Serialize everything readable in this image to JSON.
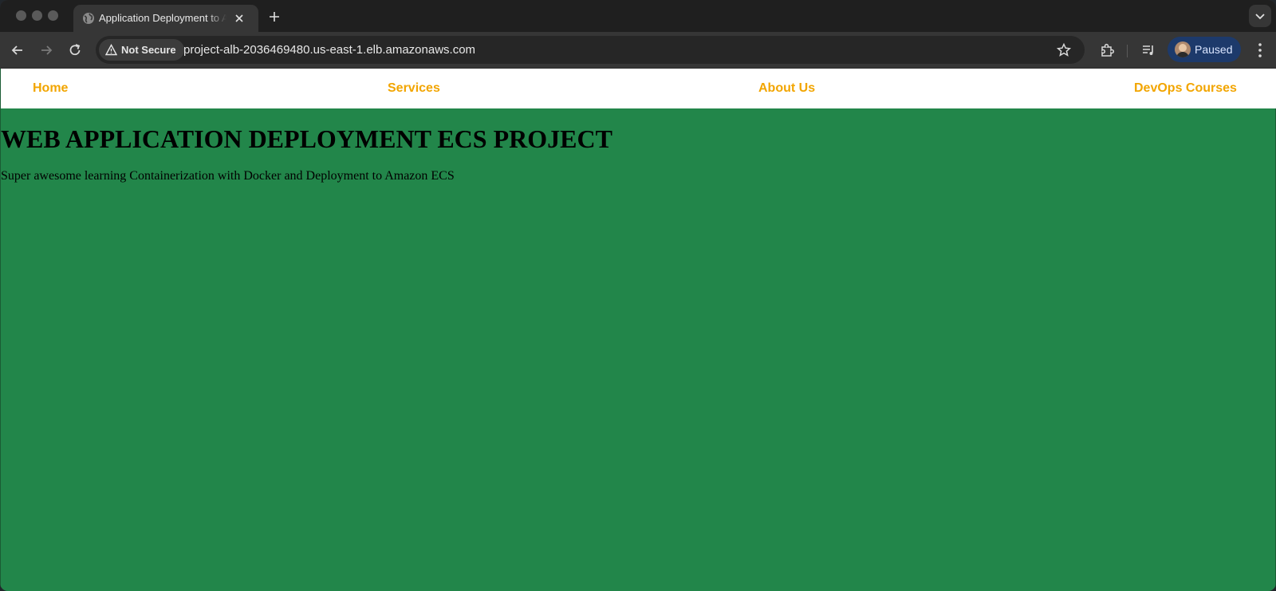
{
  "browser": {
    "tab": {
      "title": "Application Deployment to Amazon ECS",
      "favicon": "globe-icon"
    },
    "omnibox": {
      "security_label": "Not Secure",
      "url": "project-alb-2036469480.us-east-1.elb.amazonaws.com"
    },
    "profile": {
      "label": "Paused"
    },
    "icons": {
      "back": "back-arrow-icon",
      "forward": "forward-arrow-icon",
      "reload": "reload-icon",
      "bookmark": "star-icon",
      "extensions": "puzzle-icon",
      "media": "media-controls-icon",
      "menu": "kebab-menu-icon"
    }
  },
  "site": {
    "nav": [
      {
        "label": "Home"
      },
      {
        "label": "Services"
      },
      {
        "label": "About Us"
      },
      {
        "label": "DevOps Courses"
      }
    ],
    "heading": "WEB APPLICATION DEPLOYMENT ECS PROJECT",
    "tagline": "Super awesome learning Containerization with Docker and Deployment to Amazon ECS"
  },
  "colors": {
    "page_background": "#22864a",
    "nav_link": "#f2a500",
    "nav_background": "#ffffff",
    "profile_chip": "#1d3a6b"
  }
}
